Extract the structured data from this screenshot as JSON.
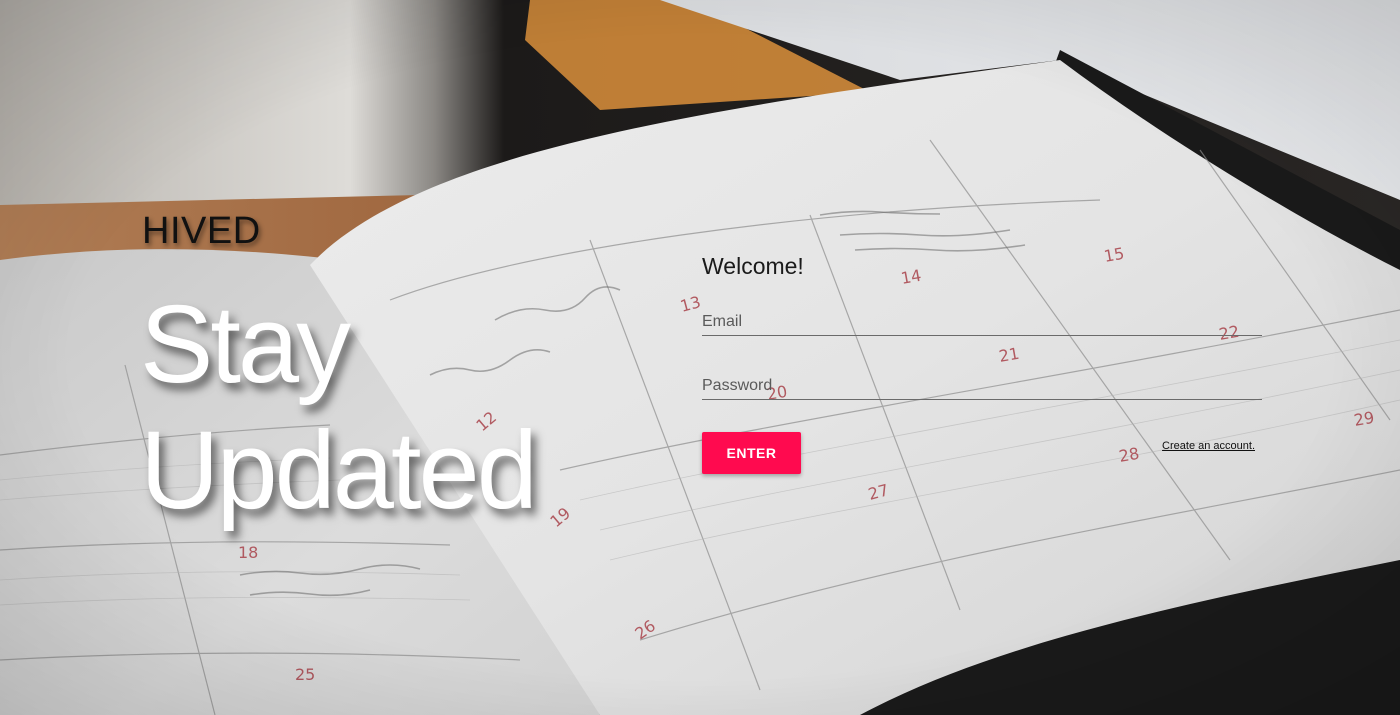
{
  "brand": {
    "name": "HIVED"
  },
  "hero": {
    "line1": "Stay",
    "line2": "Updated"
  },
  "login": {
    "welcome": "Welcome!",
    "email_placeholder": "Email",
    "password_placeholder": "Password",
    "enter_label": "ENTER",
    "create_account_label": "Create an account."
  },
  "background": {
    "calendar_numbers": [
      "13",
      "18",
      "19",
      "20",
      "21",
      "22",
      "25",
      "26",
      "27",
      "28",
      "29",
      "12",
      "14",
      "15"
    ]
  },
  "colors": {
    "accent": "#ff0a4f",
    "hero_text": "#ffffff",
    "brand_text": "#111111"
  }
}
